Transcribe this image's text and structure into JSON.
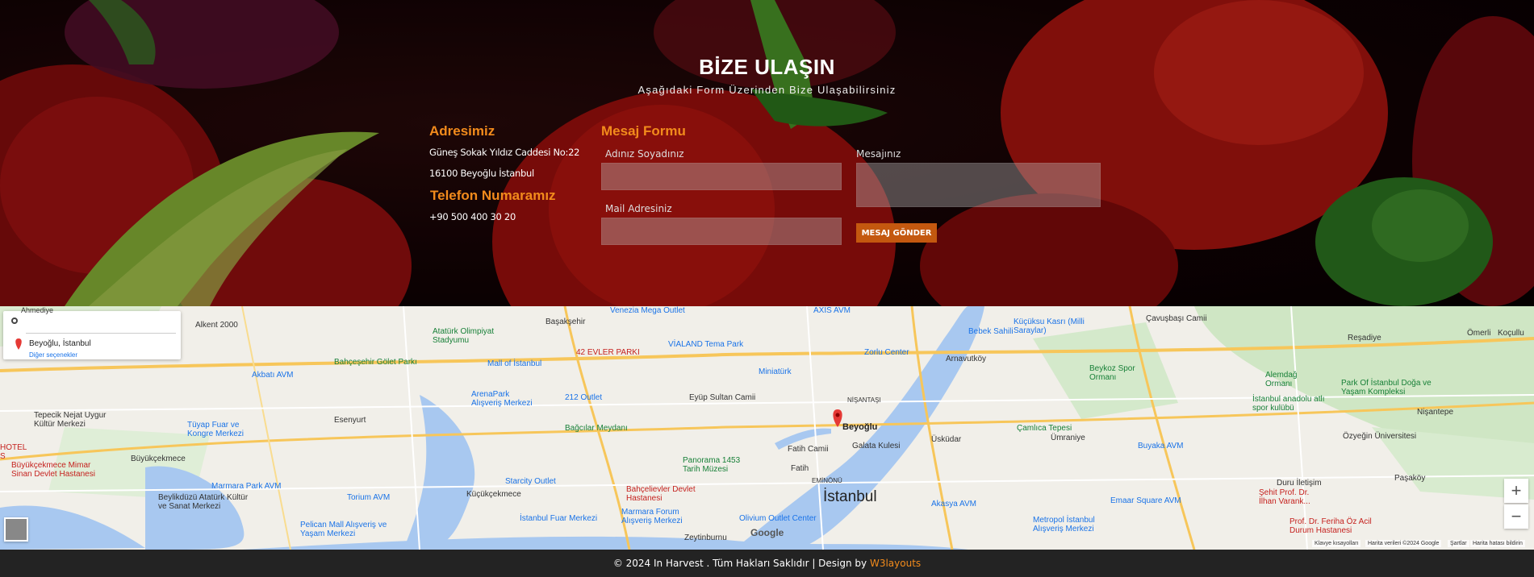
{
  "contact": {
    "title": "BİZE ULAŞIN",
    "subtitle": "Aşağıdaki Form Üzerinden Bize Ulaşabilirsiniz",
    "address_heading": "Adresimiz",
    "address_line1": "Güneş Sokak Yıldız Caddesi No:22",
    "address_line2": "16100 Beyoğlu İstanbul",
    "phone_heading": "Telefon Numaramız",
    "phone": "+90 500 400 30 20",
    "form_heading": "Mesaj Formu",
    "name_label": "Adınız Soyadınız",
    "name_value": "",
    "mail_label": "Mail Adresiniz",
    "mail_value": "",
    "message_label": "Mesajınız",
    "message_value": "",
    "submit_label": "MESAJ GÖNDER"
  },
  "map": {
    "origin_value": "",
    "destination": "Beyoğlu, İstanbul",
    "more_options": "Diğer seçenekler",
    "pin_label": "Beyoğlu",
    "city_label": "İstanbul",
    "zoom_in": "+",
    "zoom_out": "−",
    "google": "Google",
    "footer_items": [
      "Klavye kısayolları",
      "Harita verileri ©2024 Google",
      "Şartlar",
      "Harita hatası bildirin"
    ],
    "place_labels": {
      "alkent": "Alkent 2000",
      "basaksehir": "Başakşehir",
      "ataturk_stadium": "Atatürk Olimpiyat Stadyumu",
      "evler_parki": "42 EVLER PARKI",
      "vialand": "VİALAND Tema Park",
      "zorlu": "Zorlu Center",
      "axis": "AXIS AVM",
      "venezia": "Venezia Mega Outlet",
      "kucuksu": "Küçüksu Kasrı (Milli Saraylar)",
      "cavusbasi": "Çavuşbaşı Camii",
      "resadiye": "Reşadiye",
      "omerli": "Ömerli",
      "koclulu": "Koçullu",
      "bebek": "Bebek Sahili",
      "arnavutkoy": "Arnavutköy",
      "miniaturk": "Miniatürk",
      "eyup": "Eyüp Sultan Camii",
      "mall_istanbul": "Mall of İstanbul",
      "bahcesehir": "Bahçeşehir Gölet Parkı",
      "akbati": "Akbatı AVM",
      "esenyurt": "Esenyurt",
      "arena": "ArenaPark Alışveriş Merkezi",
      "outlet212": "212 Outlet",
      "bagcilar": "Bağcılar Meydanı",
      "nisantasi": "NİŞANTAŞI",
      "galata": "Galata Kulesi",
      "uskudar": "Üsküdar",
      "camlica": "Çamlıca Tepesi",
      "umraniye": "Ümraniye",
      "buyaka": "Buyaka AVM",
      "beykoz": "Beykoz Spor Ormanı",
      "alemdag": "Alemdağ Ormanı",
      "parkofistanbul": "Park Of İstanbul Doğa ve Yaşam Kompleksi",
      "anadolu": "İstanbul anadolu atlı spor kulübü",
      "nisantepe": "Nişantepe",
      "ozyegin": "Özyeğin Üniversitesi",
      "pasakoy": "Paşaköy",
      "duru": "Duru İletişim",
      "sehit": "Şehit Prof. Dr. İlhan Varank...",
      "feriha": "Prof. Dr. Feriha Öz Acil Durum Hastanesi",
      "emaar": "Emaar Square AVM",
      "metropol": "Metropol İstanbul Alışveriş Merkezi",
      "akasya": "Akasya AVM",
      "fatih_camii": "Fatih Camii",
      "fatih": "Fatih",
      "eminonu": "EMİNÖNÜ",
      "panorama": "Panorama 1453 Tarih Müzesi",
      "starcity": "Starcity Outlet",
      "bahcelievler": "Bahçelievler Devlet Hastanesi",
      "marmara_forum": "Marmara Forum Alışveriş Merkezi",
      "olivium": "Olivium Outlet Center",
      "zeytinburnu": "Zeytinburnu",
      "kucukcekmece": "Küçükçekmece",
      "istanbul_fuar": "İstanbul Fuar Merkezi",
      "torium": "Torium AVM",
      "marmara_park": "Marmara Park AVM",
      "pelican": "Pelican Mall Alışveriş ve Yaşam Merkezi",
      "tuyap": "Tüyap Fuar ve Kongre Merkezi",
      "buyukcekmece": "Büyükçekmece",
      "bc_hastane": "Büyükçekmece Mimar Sinan Devlet Hastanesi",
      "tepecik": "Tepecik Nejat Uygur Kültür Merkezi",
      "beylikduzu": "Beylikdüzü Atatürk Kültür ve Sanat Merkezi",
      "ahmediye": "Ahmediye",
      "hotel": "HOTEL S"
    }
  },
  "footer": {
    "text": "© 2024 In Harvest . Tüm Hakları Saklıdır | Design by ",
    "link": "W3layouts"
  }
}
